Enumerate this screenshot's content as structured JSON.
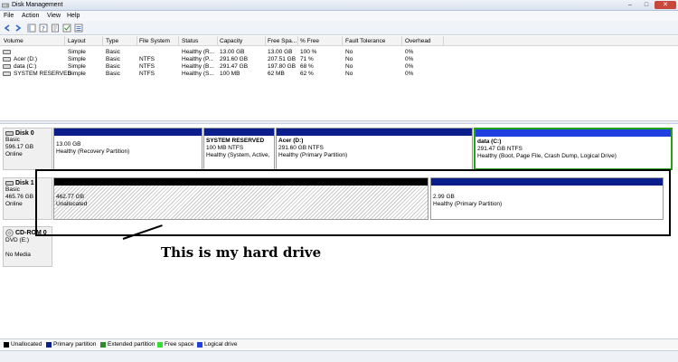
{
  "window": {
    "title": "Disk Management",
    "min": "–",
    "max": "□",
    "close": "✕"
  },
  "menu": [
    "File",
    "Action",
    "View",
    "Help"
  ],
  "volume_list": {
    "columns": [
      "Volume",
      "Layout",
      "Type",
      "File System",
      "Status",
      "Capacity",
      "Free Spa...",
      "% Free",
      "Fault Tolerance",
      "Overhead"
    ],
    "rows": [
      [
        "",
        "Simple",
        "Basic",
        "",
        "Healthy (R...",
        "13.00 GB",
        "13.00 GB",
        "100 %",
        "No",
        "0%"
      ],
      [
        "Acer (D:)",
        "Simple",
        "Basic",
        "NTFS",
        "Healthy (P...",
        "291.60 GB",
        "207.51 GB",
        "71 %",
        "No",
        "0%"
      ],
      [
        "data (C:)",
        "Simple",
        "Basic",
        "NTFS",
        "Healthy (B...",
        "291.47 GB",
        "197.80 GB",
        "68 %",
        "No",
        "0%"
      ],
      [
        "SYSTEM RESERVED",
        "Simple",
        "Basic",
        "NTFS",
        "Healthy (S...",
        "100 MB",
        "62 MB",
        "62 %",
        "No",
        "0%"
      ]
    ]
  },
  "disks": {
    "disk0": {
      "name": "Disk 0",
      "type": "Basic",
      "size": "596.17 GB",
      "status": "Online",
      "partitions": [
        {
          "name": "",
          "size": "13.00 GB",
          "status": "Healthy (Recovery Partition)"
        },
        {
          "name": "SYSTEM RESERVED",
          "size": "100 MB NTFS",
          "status": "Healthy (System, Active,"
        },
        {
          "name": "Acer  (D:)",
          "size": "291.60 GB NTFS",
          "status": "Healthy (Primary Partition)"
        },
        {
          "name": "data  (C:)",
          "size": "291.47 GB NTFS",
          "status": "Healthy (Boot, Page File, Crash Dump, Logical Drive)"
        }
      ]
    },
    "disk1": {
      "name": "Disk 1",
      "type": "Basic",
      "size": "465.76 GB",
      "status": "Online",
      "partitions": [
        {
          "size": "462.77 GB",
          "status": "Unallocated"
        },
        {
          "size": "2.99 GB",
          "status": "Healthy (Primary Partition)"
        }
      ]
    },
    "cdrom0": {
      "name": "CD-ROM 0",
      "type": "DVD (E:)",
      "status": "No Media"
    }
  },
  "annotation": {
    "text": "This is my hard drive"
  },
  "legend": [
    {
      "label": "Unallocated",
      "color": "#000000"
    },
    {
      "label": "Primary partition",
      "color": "#0b1e8c"
    },
    {
      "label": "Extended partition",
      "color": "#2e8b2e"
    },
    {
      "label": "Free space",
      "color": "#33dd33"
    },
    {
      "label": "Logical drive",
      "color": "#1f3fe0"
    }
  ]
}
